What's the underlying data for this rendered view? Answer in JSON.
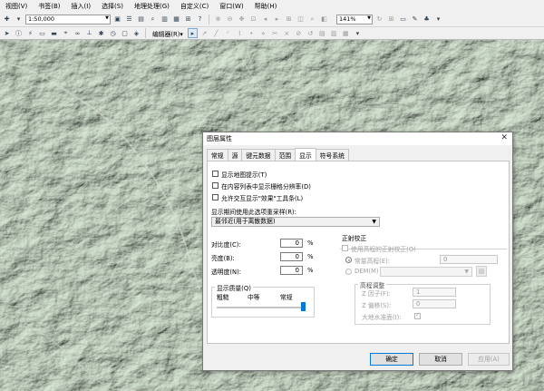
{
  "menubar": {
    "items": [
      "视图(V)",
      "书签(B)",
      "插入(I)",
      "选择(S)",
      "地理处理(G)",
      "自定义(C)",
      "窗口(W)",
      "帮助(H)"
    ]
  },
  "toolbar": {
    "scale_value": "1:50,000",
    "zoom_value": "141%",
    "editor_label": "编辑器(R)▾"
  },
  "dialog": {
    "title": "图层属性",
    "close_glyph": "✕",
    "tabs": [
      "常规",
      "源",
      "键元数据",
      "范围",
      "显示",
      "符号系统"
    ],
    "active_tab": "显示",
    "checks": {
      "show_map_tips": "显示地图提示(T)",
      "show_resolution": "在内容列表中显示栅格分辨率(D)",
      "allow_effects": "允许交互显示\"效果\"工具条(L)"
    },
    "resample": {
      "label": "显示期间使用此选项重采样(R):",
      "value": "最邻近(用于离散数据)"
    },
    "contrast": {
      "label": "对比度(C):",
      "value": "0",
      "unit": "%"
    },
    "brightness": {
      "label": "亮度(B):",
      "value": "0",
      "unit": "%"
    },
    "transparency": {
      "label": "透明度(N):",
      "value": "0",
      "unit": "%"
    },
    "quality": {
      "group_label": "显示质量(Q)",
      "coarse": "粗糙",
      "medium": "中等",
      "normal": "常规",
      "level_fraction": 1.0
    },
    "ortho": {
      "group_label": "正射校正",
      "use_elevation": "使用高程的正射校正(O)",
      "constant_label": "常量高程(E):",
      "constant_value": "0",
      "dem_label": "DEM(M)",
      "elevation_group": "高程调整",
      "z_factor_label": "Z 因子(F):",
      "z_factor_value": "1",
      "offset_label": "Z 偏移(S):",
      "offset_value": "0",
      "geoid_label": "大地水准面(I):"
    },
    "buttons": {
      "ok": "确定",
      "cancel": "取消",
      "apply": "应用(A)"
    }
  }
}
